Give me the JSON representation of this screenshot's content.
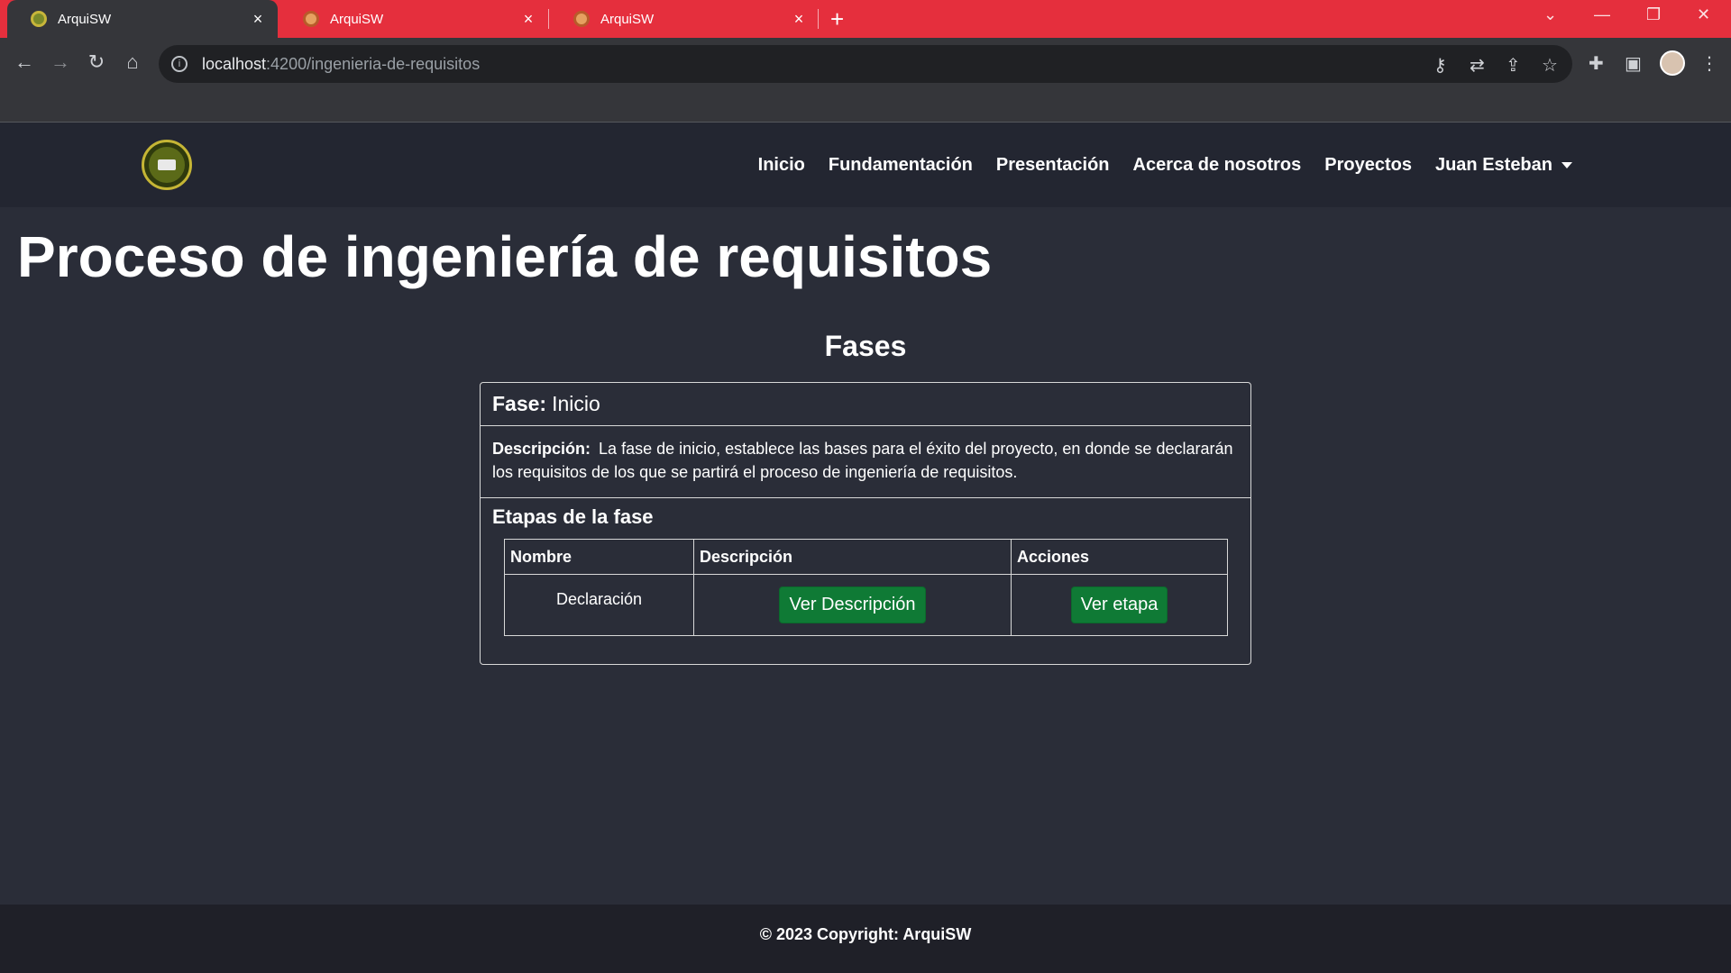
{
  "browser": {
    "tabs": [
      {
        "title": "ArquiSW",
        "active": true
      },
      {
        "title": "ArquiSW",
        "active": false
      },
      {
        "title": "ArquiSW",
        "active": false
      }
    ],
    "url_host": "localhost",
    "url_path": ":4200/ingenieria-de-requisitos",
    "tab_close_glyph": "×",
    "new_tab_glyph": "+",
    "accent_color": "#e52f3d"
  },
  "navbar": {
    "links": [
      "Inicio",
      "Fundamentación",
      "Presentación",
      "Acerca de nosotros",
      "Proyectos"
    ],
    "user": "Juan Esteban"
  },
  "page": {
    "title": "Proceso de ingeniería de requisitos",
    "section_title": "Fases"
  },
  "phase": {
    "label": "Fase:",
    "name": "Inicio",
    "desc_label": "Descripción:",
    "description": "La fase de inicio, establece las bases para el éxito del proyecto, en donde se declararán los requisitos de los que se partirá el proceso de ingeniería de requisitos.",
    "stages_title": "Etapas de la fase",
    "table": {
      "headers": [
        "Nombre",
        "Descripción",
        "Acciones"
      ],
      "rows": [
        {
          "name": "Declaración",
          "desc_button": "Ver Descripción",
          "action_button": "Ver etapa"
        }
      ]
    }
  },
  "footer": {
    "text": "© 2023 Copyright: ArquiSW"
  },
  "colors": {
    "button_green": "#0f7a35",
    "page_bg": "#2a2d38"
  }
}
